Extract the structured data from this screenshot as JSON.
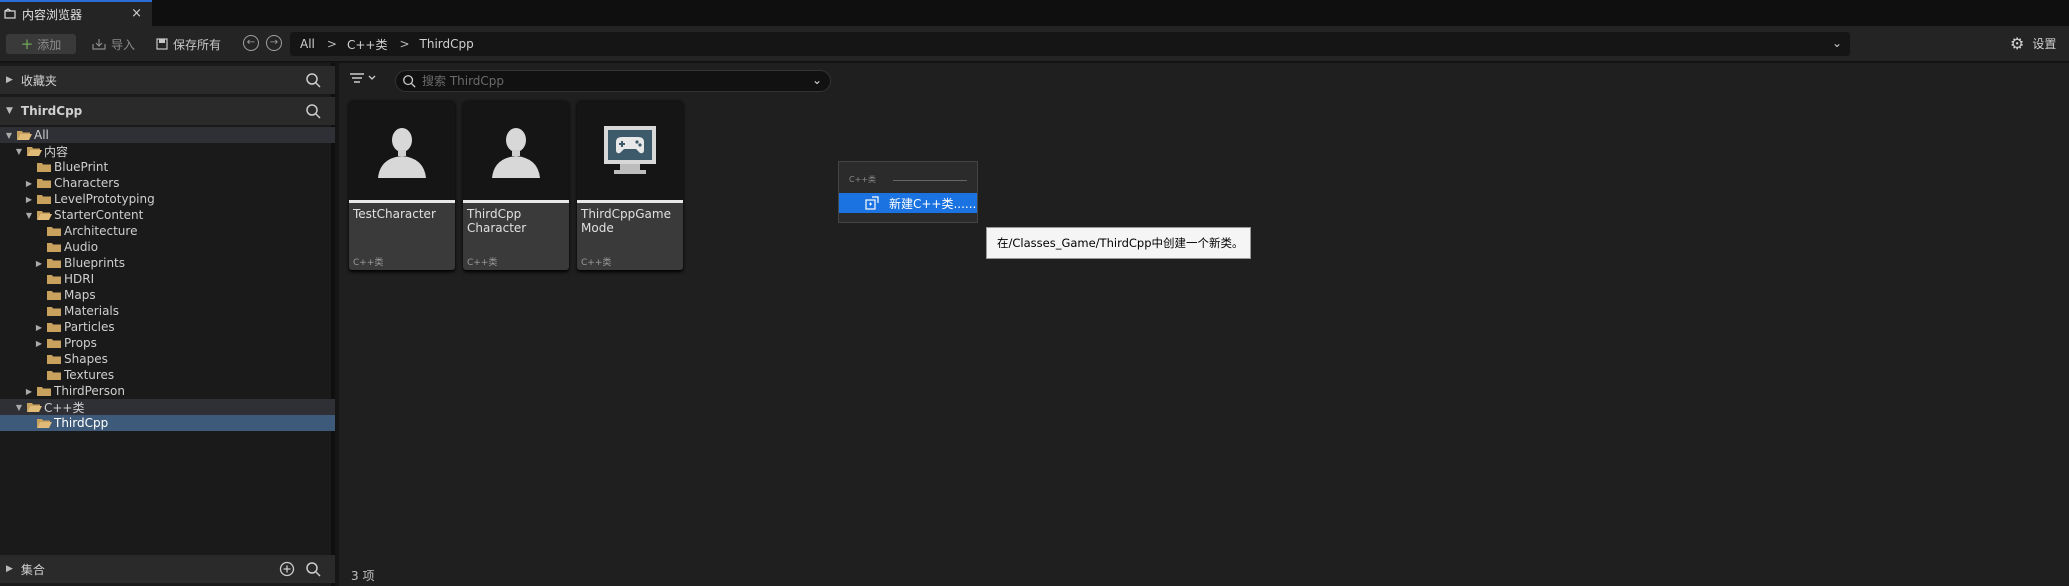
{
  "tab": {
    "title": "内容浏览器",
    "close": "×"
  },
  "toolbar": {
    "add_label": "添加",
    "import_label": "导入",
    "save_all_label": "保存所有",
    "back": "←",
    "forward": "→",
    "breadcrumb": [
      "All",
      "C++类",
      "ThirdCpp"
    ],
    "breadcrumb_sep": ">",
    "path_dropdown": "⌄",
    "settings_label": "设置"
  },
  "sidebar": {
    "favorites_label": "收藏夹",
    "project_label": "ThirdCpp",
    "collections_label": "集合",
    "tree": [
      {
        "label": "All",
        "depth": 0,
        "expanded": true,
        "open_folder": true,
        "state": "dark"
      },
      {
        "label": "内容",
        "depth": 1,
        "expanded": true,
        "open_folder": true
      },
      {
        "label": "BluePrint",
        "depth": 2,
        "expanded": null
      },
      {
        "label": "Characters",
        "depth": 2,
        "expanded": false
      },
      {
        "label": "LevelPrototyping",
        "depth": 2,
        "expanded": false
      },
      {
        "label": "StarterContent",
        "depth": 2,
        "expanded": true,
        "open_folder": true
      },
      {
        "label": "Architecture",
        "depth": 3,
        "expanded": null
      },
      {
        "label": "Audio",
        "depth": 3,
        "expanded": null
      },
      {
        "label": "Blueprints",
        "depth": 3,
        "expanded": false
      },
      {
        "label": "HDRI",
        "depth": 3,
        "expanded": null
      },
      {
        "label": "Maps",
        "depth": 3,
        "expanded": null
      },
      {
        "label": "Materials",
        "depth": 3,
        "expanded": null
      },
      {
        "label": "Particles",
        "depth": 3,
        "expanded": false
      },
      {
        "label": "Props",
        "depth": 3,
        "expanded": false
      },
      {
        "label": "Shapes",
        "depth": 3,
        "expanded": null
      },
      {
        "label": "Textures",
        "depth": 3,
        "expanded": null
      },
      {
        "label": "ThirdPerson",
        "depth": 2,
        "expanded": false
      },
      {
        "label": "C++类",
        "depth": 1,
        "expanded": true,
        "open_folder": true,
        "state": "dark"
      },
      {
        "label": "ThirdCpp",
        "depth": 2,
        "expanded": null,
        "open_folder": true,
        "state": "blue"
      }
    ]
  },
  "content": {
    "search_placeholder": "搜索 ThirdCpp",
    "items": [
      {
        "name": "TestCharacter",
        "kind": "C++类",
        "icon": "character-icon"
      },
      {
        "name": "ThirdCpp Character",
        "kind": "C++类",
        "icon": "character-icon"
      },
      {
        "name": "ThirdCppGame Mode",
        "kind": "C++类",
        "icon": "gamemode-icon"
      }
    ],
    "item_count": "3 项"
  },
  "context_menu": {
    "header": "C++类",
    "item_label": "新建C++类......"
  },
  "tooltip": {
    "text": "在/Classes_Game/ThirdCpp中创建一个新类。"
  },
  "colors": {
    "accent": "#1a73e0",
    "folder": "#c9a15e",
    "selection": "#3e5a7a"
  }
}
